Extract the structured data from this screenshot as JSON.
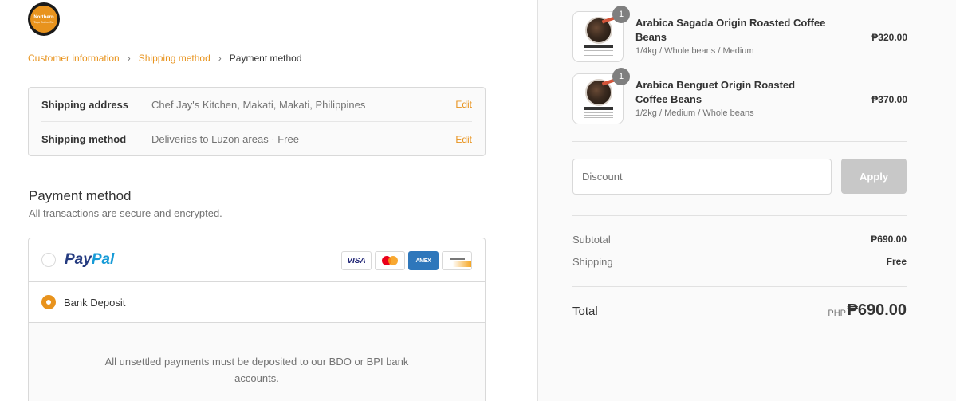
{
  "logo": {
    "line1": "Northern",
    "line2": "Tuyo Coffee Co."
  },
  "breadcrumb": {
    "items": [
      {
        "label": "Customer information"
      },
      {
        "label": "Shipping method"
      },
      {
        "label": "Payment method"
      }
    ]
  },
  "review": {
    "address_label": "Shipping address",
    "address_value": "Chef Jay's Kitchen, Makati, Makati, Philippines",
    "method_label": "Shipping method",
    "method_value": "Deliveries to Luzon areas · Free",
    "edit_label": "Edit"
  },
  "payment": {
    "title": "Payment method",
    "subtitle": "All transactions are secure and encrypted.",
    "paypal": {
      "part1": "Pay",
      "part2": "Pal",
      "selected": false
    },
    "cards": [
      "VISA",
      "AMEX"
    ],
    "bank": {
      "label": "Bank Deposit",
      "selected": true,
      "detail": "All unsettled payments must be deposited to our BDO or BPI bank accounts."
    }
  },
  "cart": {
    "items": [
      {
        "name": "Arabica Sagada Origin Roasted Coffee Beans",
        "variant": "1/4kg / Whole beans / Medium",
        "price": "₱320.00",
        "quantity": "1"
      },
      {
        "name": "Arabica Benguet Origin Roasted Coffee Beans",
        "variant": "1/2kg / Medium / Whole beans",
        "price": "₱370.00",
        "quantity": "1"
      }
    ],
    "discount_placeholder": "Discount",
    "apply_label": "Apply",
    "subtotal_label": "Subtotal",
    "subtotal_value": "₱690.00",
    "shipping_label": "Shipping",
    "shipping_value": "Free",
    "total_label": "Total",
    "total_currency": "PHP",
    "total_value": "₱690.00"
  },
  "colors": {
    "accent": "#e8931d",
    "text": "#333333",
    "muted": "#737373",
    "border": "#d9d9d9"
  }
}
